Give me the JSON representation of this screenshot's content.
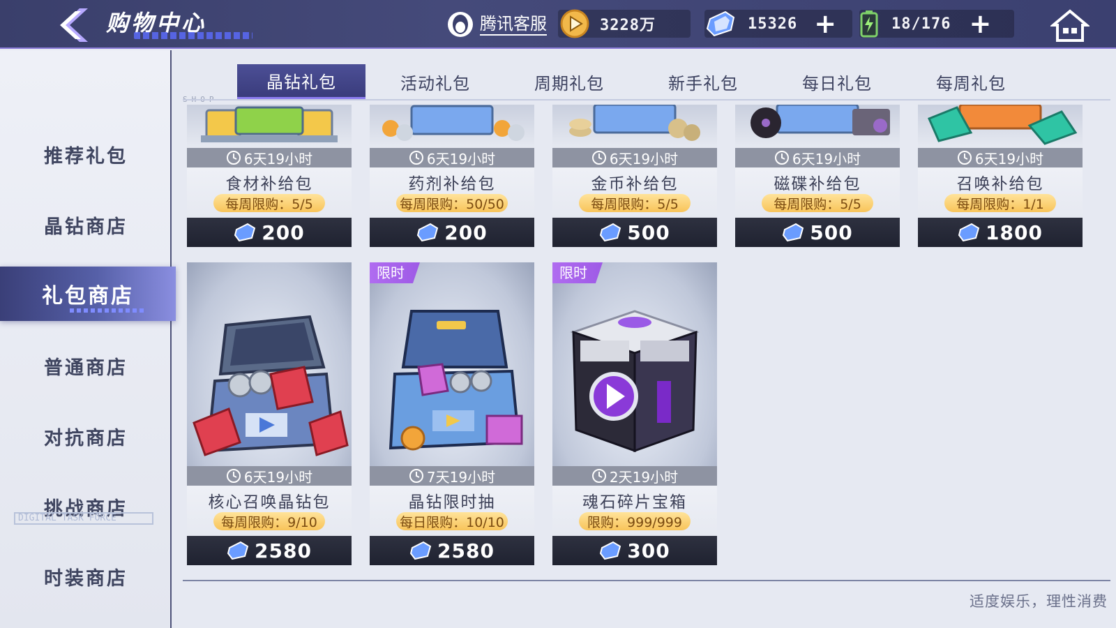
{
  "header": {
    "title": "购物中心",
    "customer_service": "腾讯客服",
    "gold": "3228万",
    "gems": "15326",
    "stamina": "18/176",
    "plus_symbol": "+"
  },
  "sidebar": {
    "items": [
      {
        "label": "推荐礼包"
      },
      {
        "label": "晶钻商店"
      },
      {
        "label": "礼包商店"
      },
      {
        "label": "普通商店"
      },
      {
        "label": "对抗商店"
      },
      {
        "label": "挑战商店"
      },
      {
        "label": "时装商店"
      }
    ],
    "active_index": 2,
    "watermark": "DIGITAL TASK FORCE"
  },
  "tabs": {
    "items": [
      {
        "label": "晶钻礼包"
      },
      {
        "label": "活动礼包"
      },
      {
        "label": "周期礼包"
      },
      {
        "label": "新手礼包"
      },
      {
        "label": "每日礼包"
      },
      {
        "label": "每周礼包"
      }
    ],
    "active_index": 0,
    "shop_tag": "SHOP"
  },
  "packs_row1": [
    {
      "timer": "6天19小时",
      "name": "食材补给包",
      "limit": "每周限购：5/5",
      "price": "200",
      "icon": "food-crate"
    },
    {
      "timer": "6天19小时",
      "name": "药剂补给包",
      "limit": "每周限购：50/50",
      "price": "200",
      "icon": "potion-crate"
    },
    {
      "timer": "6天19小时",
      "name": "金币补给包",
      "limit": "每周限购：5/5",
      "price": "500",
      "icon": "coin-crate"
    },
    {
      "timer": "6天19小时",
      "name": "磁碟补给包",
      "limit": "每周限购：5/5",
      "price": "500",
      "icon": "disc-crate"
    },
    {
      "timer": "6天19小时",
      "name": "召唤补给包",
      "limit": "每周限购：1/1",
      "price": "1800",
      "icon": "summon-crate"
    }
  ],
  "packs_row2": [
    {
      "badge": "",
      "timer": "6天19小时",
      "name": "核心召唤晶钻包",
      "limit": "每周限购：9/10",
      "price": "2580",
      "icon": "core-summon-chest"
    },
    {
      "badge": "限时",
      "timer": "7天19小时",
      "name": "晶钻限时抽",
      "limit": "每日限购：10/10",
      "price": "2580",
      "icon": "gem-draw-chest"
    },
    {
      "badge": "限时",
      "timer": "2天19小时",
      "name": "魂石碎片宝箱",
      "limit": "限购：999/999",
      "price": "300",
      "icon": "soulstone-box"
    }
  ],
  "footer": {
    "notice": "适度娱乐，理性消费"
  },
  "colors": {
    "accent": "#4c4f96",
    "limit_badge": "#f8c45a",
    "timed_badge": "#a962ea"
  }
}
